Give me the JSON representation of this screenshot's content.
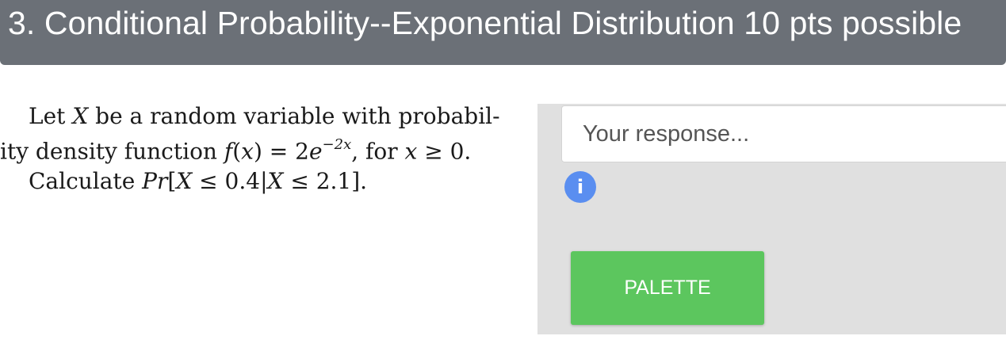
{
  "header": {
    "title": "3. Conditional Probability--Exponential Distribution 10 pts possible"
  },
  "question": {
    "line1": "Let X be a random variable with probabil-",
    "line2": "ity density function f(x) = 2e^(−2x), for x ≥ 0.",
    "line3": "Calculate Pr[X ≤ 0.4|X ≤ 2.1]."
  },
  "response": {
    "placeholder": "Your response...",
    "value": ""
  },
  "info": {
    "glyph": "i",
    "icon": "info-icon"
  },
  "palette": {
    "label": "PALETTE"
  },
  "colors": {
    "header_bg": "#6b7077",
    "palette_button": "#5cc65e",
    "info_icon": "#5a8ef0",
    "panel_bg": "#e0e0e0"
  }
}
